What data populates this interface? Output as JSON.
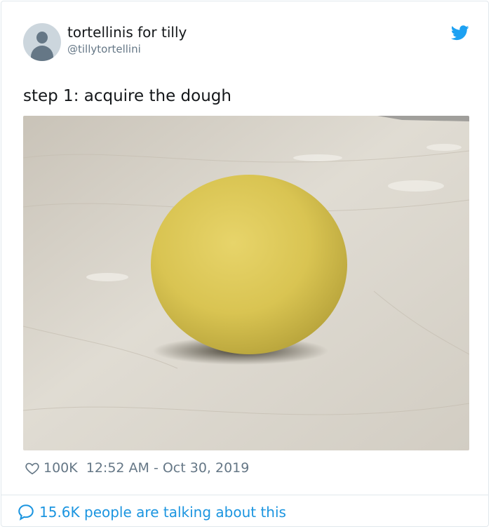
{
  "user": {
    "name": "tortellinis for tilly",
    "handle": "@tillytortellini"
  },
  "tweet": {
    "text": "step 1: acquire the dough",
    "image_alt": "ball of yellow pasta dough on a floured wooden board"
  },
  "meta": {
    "likes": "100K",
    "timestamp": "12:52 AM - Oct 30, 2019"
  },
  "footer": {
    "talking_text": "15.6K people are talking about this"
  },
  "colors": {
    "brand_blue": "#1da1f2",
    "link_blue": "#1b95e0",
    "muted_gray": "#657786",
    "text_dark": "#14171a",
    "border": "#e1e8ed"
  },
  "icons": {
    "brand": "twitter-bird-icon",
    "like": "heart-icon",
    "reply": "speech-bubble-icon"
  }
}
